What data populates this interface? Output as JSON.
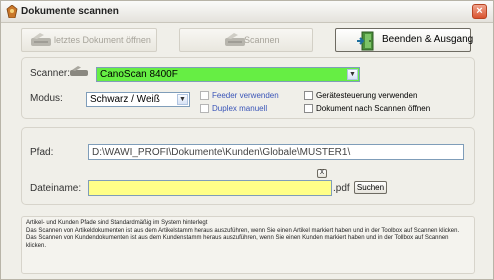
{
  "window": {
    "title": "Dokumente scannen",
    "close_symbol": "×"
  },
  "toolbar": {
    "open_last_label": "letztes Dokument öffnen",
    "scan_label": "Scannen",
    "exit_label": "Beenden & Ausgang"
  },
  "scanner": {
    "label": "Scanner:",
    "value": "CanoScan 8400F",
    "highlight_color": "#66ee44"
  },
  "modus": {
    "label": "Modus:",
    "value": "Schwarz / Weiß"
  },
  "options": {
    "feeder_label": "Feeder verwenden",
    "duplex_label": "Duplex manuell",
    "device_control_label": "Gerätesteuerung verwenden",
    "open_after_scan_label": "Dokument nach Scannen öffnen"
  },
  "path": {
    "label": "Pfad:",
    "value": "D:\\WAWI_PROFI\\Dokumente\\Kunden\\Globale\\MUSTER1\\"
  },
  "filename": {
    "label": "Dateiname:",
    "value": "",
    "extension": ".pdf",
    "clear_label": "X",
    "search_label": "Suchen",
    "highlight_color": "#ffff88"
  },
  "info_lines": [
    "Artikel- und Kunden Pfade sind Standardmäßig im System hinterlegt",
    "Das Scannen von Artikeldokumenten ist aus dem Artikelstamm heraus auszuführen, wenn Sie einen Artikel markiert haben und in der Toolbox auf Scannen klicken.",
    "Das Scannen von Kundendokumenten ist aus dem Kundenstamm heraus auszuführen, wenn Sie einen Kunden markiert haben und in der Tollbox auf Scannen klicken."
  ],
  "icons": {
    "title": "app-icon",
    "open_last": "scanner-icon",
    "scan": "scanner-icon",
    "exit": "exit-door-icon",
    "scanner_label": "scanner-icon"
  }
}
